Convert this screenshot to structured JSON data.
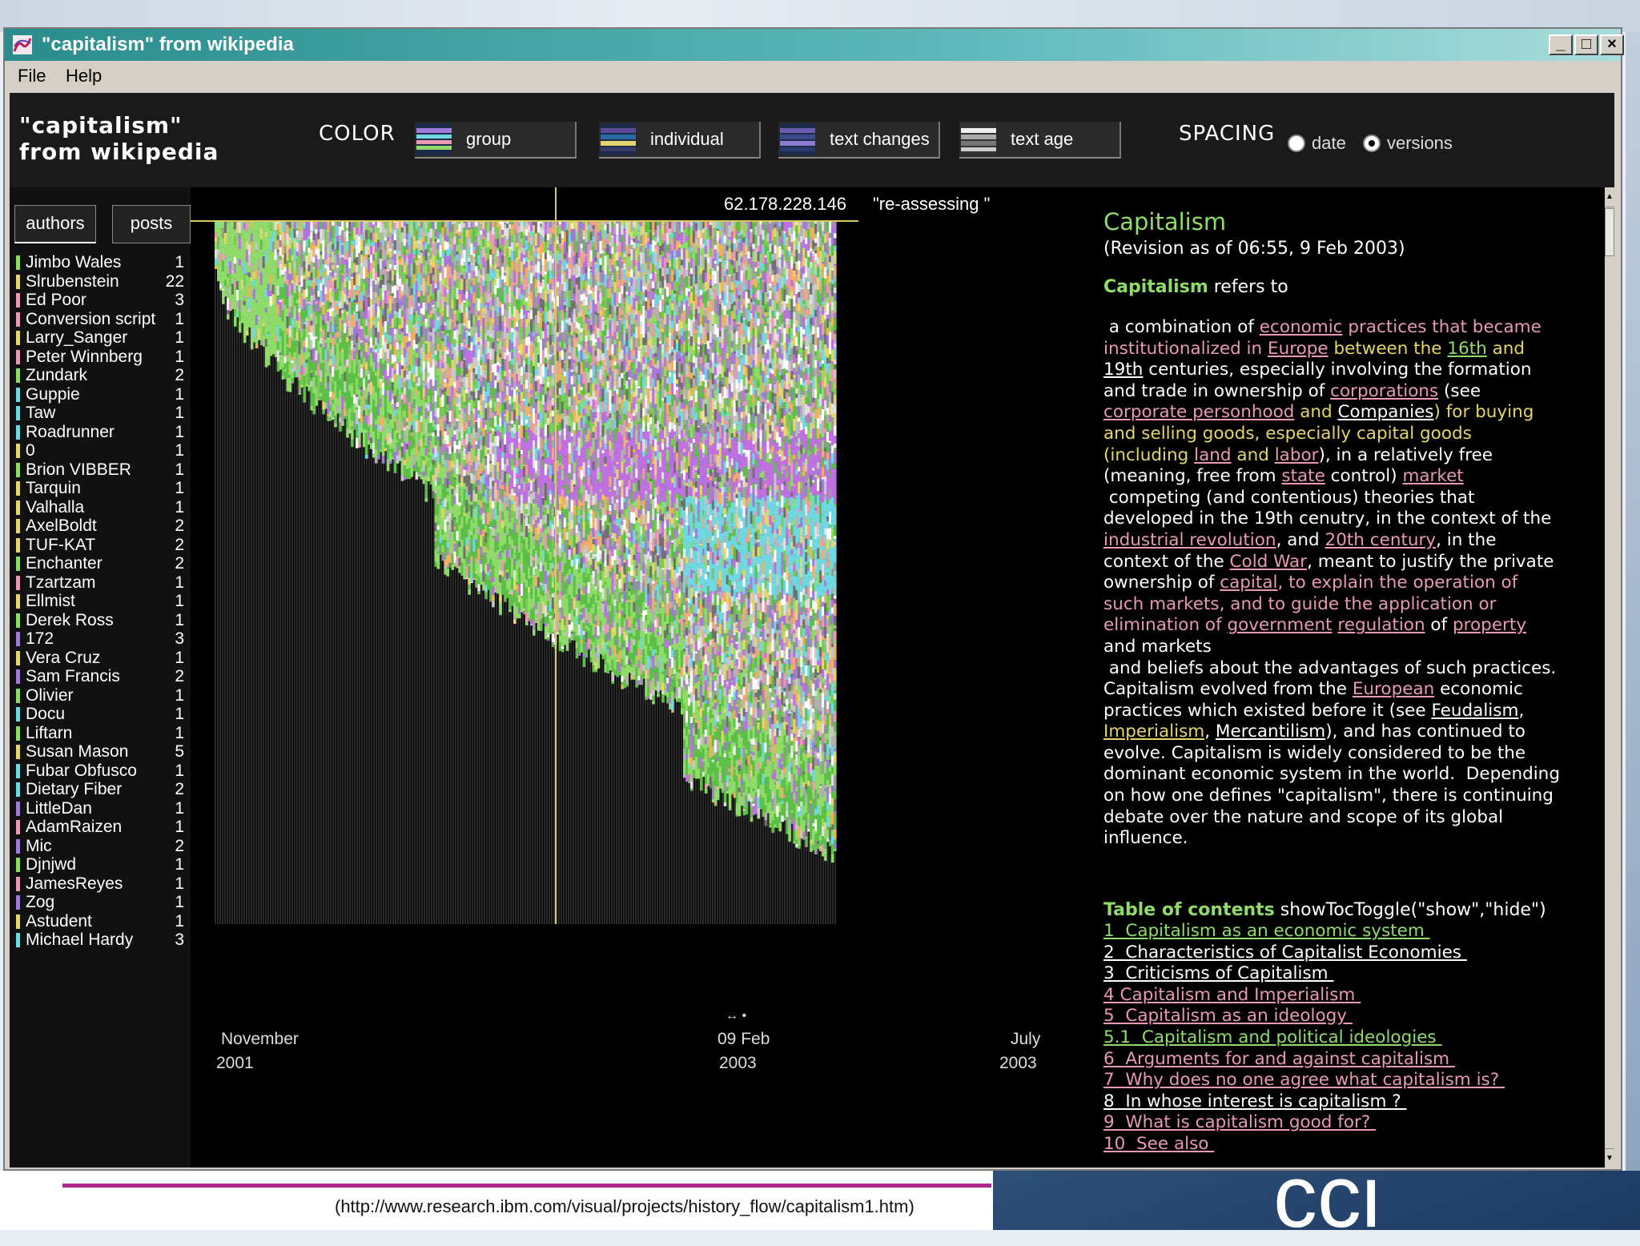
{
  "window": {
    "title": "\"capitalism\" from wikipedia",
    "menu": [
      "File",
      "Help"
    ]
  },
  "header": {
    "doc_title_line1": "\"capitalism\"",
    "doc_title_line2": "from wikipedia",
    "color_label": "COLOR",
    "color_modes": [
      "group",
      "individual",
      "text changes",
      "text age"
    ],
    "spacing_label": "SPACING",
    "spacing_options": [
      "date",
      "versions"
    ],
    "spacing_selected": "versions"
  },
  "left_panel": {
    "tabs": [
      "authors",
      "posts"
    ],
    "authors": [
      {
        "name": "Jimbo Wales",
        "count": "1",
        "color": "#8fdc6a"
      },
      {
        "name": "Slrubenstein",
        "count": "22",
        "color": "#e4d66c"
      },
      {
        "name": "Ed Poor",
        "count": "3",
        "color": "#e89ab0"
      },
      {
        "name": "Conversion script",
        "count": "1",
        "color": "#e89ab0"
      },
      {
        "name": "Larry_Sanger",
        "count": "1",
        "color": "#e4d66c"
      },
      {
        "name": "Peter Winnberg",
        "count": "1",
        "color": "#e89ab0"
      },
      {
        "name": "Zundark",
        "count": "2",
        "color": "#8fdc6a"
      },
      {
        "name": "Guppie",
        "count": "1",
        "color": "#70d8e0"
      },
      {
        "name": "Taw",
        "count": "1",
        "color": "#70d8e0"
      },
      {
        "name": "Roadrunner",
        "count": "1",
        "color": "#70d8e0"
      },
      {
        "name": "0",
        "count": "1",
        "color": "#e4d66c"
      },
      {
        "name": "Brion VIBBER",
        "count": "1",
        "color": "#8fdc6a"
      },
      {
        "name": "Tarquin",
        "count": "1",
        "color": "#e4d66c"
      },
      {
        "name": "Valhalla",
        "count": "1",
        "color": "#e4d66c"
      },
      {
        "name": "AxelBoldt",
        "count": "2",
        "color": "#e4d66c"
      },
      {
        "name": "TUF-KAT",
        "count": "2",
        "color": "#e4d66c"
      },
      {
        "name": "Enchanter",
        "count": "2",
        "color": "#8fdc6a"
      },
      {
        "name": "Tzartzam",
        "count": "1",
        "color": "#e89ab0"
      },
      {
        "name": "Ellmist",
        "count": "1",
        "color": "#e4d66c"
      },
      {
        "name": "Derek Ross",
        "count": "1",
        "color": "#8fdc6a"
      },
      {
        "name": "172",
        "count": "3",
        "color": "#a07ad8"
      },
      {
        "name": "Vera Cruz",
        "count": "1",
        "color": "#e4d66c"
      },
      {
        "name": "Sam Francis",
        "count": "2",
        "color": "#a07ad8"
      },
      {
        "name": "Olivier",
        "count": "1",
        "color": "#8fdc6a"
      },
      {
        "name": "Docu",
        "count": "1",
        "color": "#70d8e0"
      },
      {
        "name": "Liftarn",
        "count": "1",
        "color": "#8fdc6a"
      },
      {
        "name": "Susan Mason",
        "count": "5",
        "color": "#e4d66c"
      },
      {
        "name": "Fubar Obfusco",
        "count": "1",
        "color": "#70d8e0"
      },
      {
        "name": "Dietary Fiber",
        "count": "2",
        "color": "#70d8e0"
      },
      {
        "name": "LittleDan",
        "count": "1",
        "color": "#a07ad8"
      },
      {
        "name": "AdamRaizen",
        "count": "1",
        "color": "#e89ab0"
      },
      {
        "name": "Mic",
        "count": "2",
        "color": "#a07ad8"
      },
      {
        "name": "Djnjwd",
        "count": "1",
        "color": "#8fdc6a"
      },
      {
        "name": "JamesReyes",
        "count": "1",
        "color": "#e89ab0"
      },
      {
        "name": "Zog",
        "count": "1",
        "color": "#a07ad8"
      },
      {
        "name": "Astudent",
        "count": "1",
        "color": "#e4d66c"
      },
      {
        "name": "Michael Hardy",
        "count": "3",
        "color": "#70d8e0"
      }
    ]
  },
  "viz": {
    "cursor_ip": "62.178.228.146",
    "cursor_comment": "\"re-assessing \"",
    "axis": {
      "start_month": "November",
      "start_year": "2001",
      "mid_date": "09 Feb",
      "mid_year": "2003",
      "end_month": "July",
      "end_year": "2003"
    }
  },
  "article": {
    "title": "Capitalism",
    "revision": "(Revision as of 06:55, 9 Feb 2003)",
    "intro_bold": "Capitalism",
    "intro_rest": " refers to",
    "toc_heading_bold": "Table of contents",
    "toc_heading_rest": " showTocToggle(\"show\",\"hide\")",
    "toc": [
      {
        "label": "1  Capitalism as an economic system ",
        "color": "#8fdc6a"
      },
      {
        "label": "2  Characteristics of Capitalist Economies ",
        "color": "#ffffff"
      },
      {
        "label": "3  Criticisms of Capitalism ",
        "color": "#ffffff"
      },
      {
        "label": "4 Capitalism and Imperialism ",
        "color": "#e89ab0"
      },
      {
        "label": "5  Capitalism as an ideology ",
        "color": "#e89ab0"
      },
      {
        "label": "5.1  Capitalism and political ideologies ",
        "color": "#8fdc6a"
      },
      {
        "label": "6  Arguments for and against capitalism ",
        "color": "#e89ab0"
      },
      {
        "label": "7  Why does no one agree what capitalism is? ",
        "color": "#e89ab0"
      },
      {
        "label": "8  In whose interest is capitalism ? ",
        "color": "#ffffff"
      },
      {
        "label": "9  What is capitalism good for? ",
        "color": "#e89ab0"
      },
      {
        "label": "10  See also ",
        "color": "#e89ab0"
      }
    ],
    "body_lines": [
      [
        {
          "t": " a combination of "
        },
        {
          "t": "economic",
          "c": "p",
          "u": true
        },
        {
          "t": " practices that became",
          "c": "p"
        }
      ],
      [
        {
          "t": "institutionalized in ",
          "c": "p"
        },
        {
          "t": "Europe",
          "c": "p",
          "u": true
        },
        {
          "t": " between the ",
          "c": "y"
        },
        {
          "t": "16th",
          "c": "g",
          "u": true
        },
        {
          "t": " and",
          "c": "y"
        }
      ],
      [
        {
          "t": "19th",
          "u": true
        },
        {
          "t": " centuries, especially involving the formation"
        }
      ],
      [
        {
          "t": "and trade in ownership of "
        },
        {
          "t": "corporations",
          "c": "p",
          "u": true
        },
        {
          "t": " (see"
        }
      ],
      [
        {
          "t": "corporate personhood",
          "c": "p",
          "u": true
        },
        {
          "t": " and ",
          "c": "y"
        },
        {
          "t": "Companies",
          "u": true
        },
        {
          "t": ") for buying",
          "c": "y"
        }
      ],
      [
        {
          "t": "and selling goods, especially capital goods",
          "c": "y"
        }
      ],
      [
        {
          "t": "(including ",
          "c": "y"
        },
        {
          "t": "land",
          "c": "p",
          "u": true
        },
        {
          "t": " and ",
          "c": "y"
        },
        {
          "t": "labor",
          "c": "p",
          "u": true
        },
        {
          "t": "), in a relatively free"
        }
      ],
      [
        {
          "t": "(meaning, free from "
        },
        {
          "t": "state",
          "c": "p",
          "u": true
        },
        {
          "t": " control) "
        },
        {
          "t": "market",
          "c": "p",
          "u": true
        }
      ],
      [
        {
          "t": " competing (and contentious) theories that"
        }
      ],
      [
        {
          "t": "developed in the 19th cenutry, in the context of the"
        }
      ],
      [
        {
          "t": "industrial revolution",
          "c": "p",
          "u": true
        },
        {
          "t": ", and "
        },
        {
          "t": "20th century",
          "c": "p",
          "u": true
        },
        {
          "t": ", in the"
        }
      ],
      [
        {
          "t": "context of the "
        },
        {
          "t": "Cold War",
          "c": "p",
          "u": true
        },
        {
          "t": ", meant to justify the private"
        }
      ],
      [
        {
          "t": "ownership of "
        },
        {
          "t": "capital",
          "c": "p",
          "u": true
        },
        {
          "t": ", to explain the operation of",
          "c": "p"
        }
      ],
      [
        {
          "t": "such markets, and to guide the application or",
          "c": "p"
        }
      ],
      [
        {
          "t": "elimination of ",
          "c": "p"
        },
        {
          "t": "government",
          "c": "p",
          "u": true
        },
        {
          "t": " "
        },
        {
          "t": "regulation",
          "c": "p",
          "u": true
        },
        {
          "t": " of "
        },
        {
          "t": "property",
          "c": "p",
          "u": true
        }
      ],
      [
        {
          "t": "and markets"
        }
      ],
      [
        {
          "t": " and beliefs about the advantages of such practices."
        }
      ],
      [
        {
          "t": "Capitalism evolved from the "
        },
        {
          "t": "European",
          "c": "p",
          "u": true
        },
        {
          "t": " economic"
        }
      ],
      [
        {
          "t": "practices which existed before it (see "
        },
        {
          "t": "Feudalism",
          "u": true
        },
        {
          "t": ","
        }
      ],
      [
        {
          "t": "Imperialism",
          "c": "y",
          "u": true
        },
        {
          "t": ", "
        },
        {
          "t": "Mercantilism",
          "u": true
        },
        {
          "t": "), and has continued to"
        }
      ],
      [
        {
          "t": "evolve. Capitalism is widely considered to be the"
        }
      ],
      [
        {
          "t": "dominant economic system in the world.  Depending"
        }
      ],
      [
        {
          "t": "on how one defines \"capitalism\", there is continuing"
        }
      ],
      [
        {
          "t": "debate over the nature and scope of its global"
        }
      ],
      [
        {
          "t": "influence."
        }
      ]
    ]
  },
  "footer": {
    "source_url": "(http://www.research.ibm.com/visual/projects/history_flow/capitalism1.htm)",
    "logo_text": "cci"
  },
  "colors": {
    "green": "#8fdc6a",
    "pink": "#e89ab0",
    "yellow": "#e4d66c",
    "cyan": "#70d8e0",
    "purple": "#a07ad8",
    "titlebar": "#2a8c8c"
  }
}
